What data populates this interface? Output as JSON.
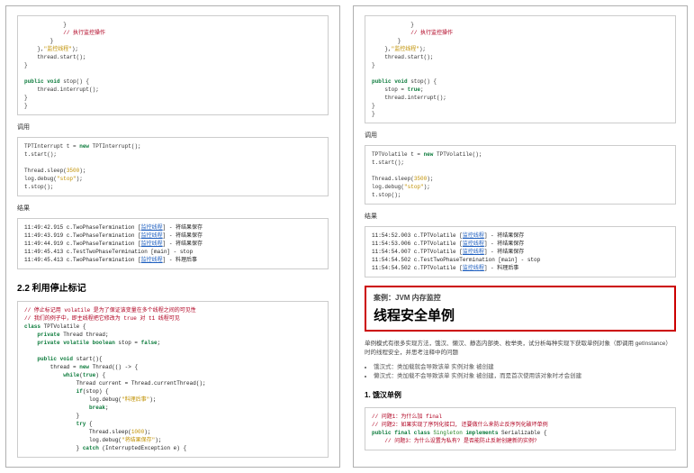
{
  "left": {
    "code1": "            }\n            // 执行监控操作\n        }\n    },\"监控线程\");\n    thread.start();\n}\n\npublic void stop() {\n    thread.interrupt();\n}\n}",
    "label_call": "调用",
    "code2": "TPTInterrupt t = new TPTInterrupt();\nt.start();\n\nThread.sleep(3500);\nlog.debug(\"stop\");\nt.stop();",
    "label_result": "结果",
    "code3": "11:49:42.915 c.TwoPhaseTermination [监控线程] - 将结果保存\n11:49:43.919 c.TwoPhaseTermination [监控线程] - 将结果保存\n11:49:44.919 c.TwoPhaseTermination [监控线程] - 将结果保存\n11:49:45.413 c.TestTwoPhaseTermination [main] - stop\n11:49:45.413 c.TwoPhaseTermination [监控线程] - 料理后事",
    "section_title": "2.2 利用停止标记",
    "code4": "// 停止标记用 volatile 是为了保证该变量在多个线程之间的可见性\n// 我们的例子中，即主线程把它修改为 true 对 t1 线程可见\nclass TPTVolatile {\n    private Thread thread;\n    private volatile boolean stop = false;\n\n    public void start(){\n        thread = new Thread(() -> {\n            while(true) {\n                Thread current = Thread.currentThread();\n                if(stop) {\n                    log.debug(\"料理后事\");\n                    break;\n                }\n                try {\n                    Thread.sleep(1000);\n                    log.debug(\"将结果保存\");\n                } catch (InterruptedException e) {"
  },
  "right": {
    "code1": "            }\n            // 执行监控操作\n        }\n    },\"监控线程\");\n    thread.start();\n}\n\npublic void stop() {\n    stop = true;\n    thread.interrupt();\n}\n}",
    "label_call": "调用",
    "code2": "TPTVolatile t = new TPTVolatile();\nt.start();\n\nThread.sleep(3500);\nlog.debug(\"stop\");\nt.stop();",
    "label_result": "结果",
    "code3": "11:54:52.003 c.TPTVolatile [监控线程] - 将结果保存\n11:54:53.006 c.TPTVolatile [监控线程] - 将结果保存\n11:54:54.007 c.TPTVolatile [监控线程] - 将结果保存\n11:54:54.502 c.TestTwoPhaseTermination [main] - stop\n11:54:54.502 c.TPTVolatile [监控线程] - 料理后事",
    "hb_sub": "案例：JVM 内存监控",
    "hb_title": "线程安全单例",
    "para": "单例模式有很多实现方法，饿汉、懒汉、静态内部类、枚举类，试分析每种实现下获取单例对象（即调用 getInstance）时的线程安全，并思考注释中的问题",
    "bullet1": "饿汉式：类加载就会导致该单 实例对象 被创建",
    "bullet2": "懒汉式：类加载不会导致该单 实例对象 被创建，而是首次使用该对象时才会创建",
    "h4": "1. 饿汉单例",
    "code4": "// 问题1：为什么加 final\n// 问题2：如果实现了序列化接口, 还要做什么来防止反序列化破坏单例\npublic final class Singleton implements Serializable {\n    // 问题3：为什么设置为私有? 是否能防止反射创建新的实例?"
  }
}
